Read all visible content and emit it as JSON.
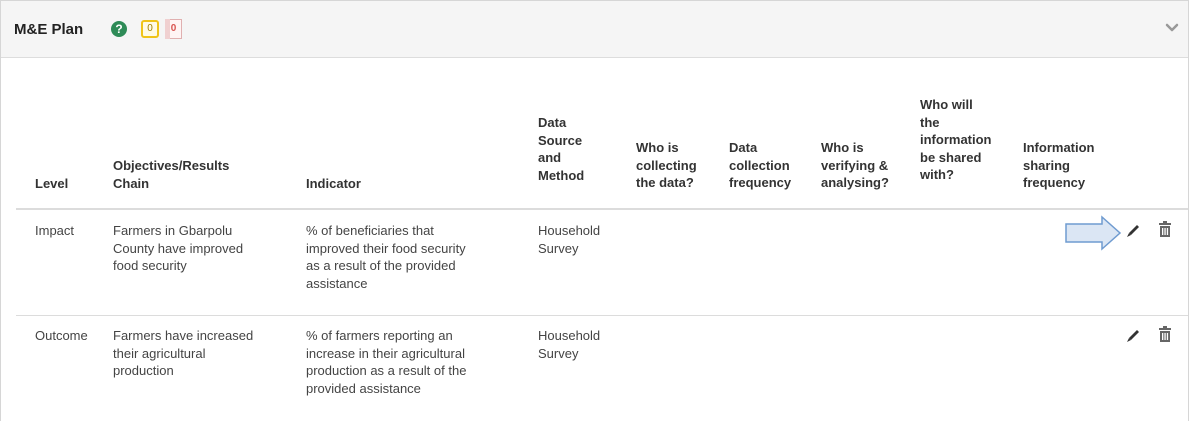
{
  "panel": {
    "title": "M&E Plan",
    "help_glyph": "?",
    "badge_yellow": "0",
    "badge_doc": "0",
    "icons": {
      "help": "question-circle-icon",
      "collapse": "chevron-down-icon",
      "edit": "pencil-icon",
      "delete": "trash-icon",
      "pointer": "arrow-right-icon"
    }
  },
  "table": {
    "headers": [
      [
        "Level"
      ],
      [
        "Objectives/Results",
        "Chain"
      ],
      [
        "Indicator"
      ],
      [
        "Data",
        "Source",
        "and",
        "Method"
      ],
      [
        "Who is",
        "collecting",
        "the data?"
      ],
      [
        "Data",
        "collection",
        "frequency"
      ],
      [
        "Who is",
        "verifying &",
        "analysing?"
      ],
      [
        "Who will",
        "the",
        "information",
        "be shared",
        "with?"
      ],
      [
        "Information",
        "sharing",
        "frequency"
      ]
    ],
    "rows": [
      {
        "level": "Impact",
        "objective": [
          "Farmers in Gbarpolu",
          "County have improved",
          "food security"
        ],
        "indicator": [
          "% of beneficiaries that",
          "improved their food security",
          "as a result of the provided",
          "assistance"
        ],
        "data_source": [
          "Household",
          "Survey"
        ]
      },
      {
        "level": "Outcome",
        "objective": [
          "Farmers have increased",
          "their agricultural",
          "production"
        ],
        "indicator": [
          "% of farmers reporting an",
          "increase in their agricultural",
          "production as a result of the",
          "provided assistance"
        ],
        "data_source": [
          "Household",
          "Survey"
        ]
      }
    ]
  }
}
